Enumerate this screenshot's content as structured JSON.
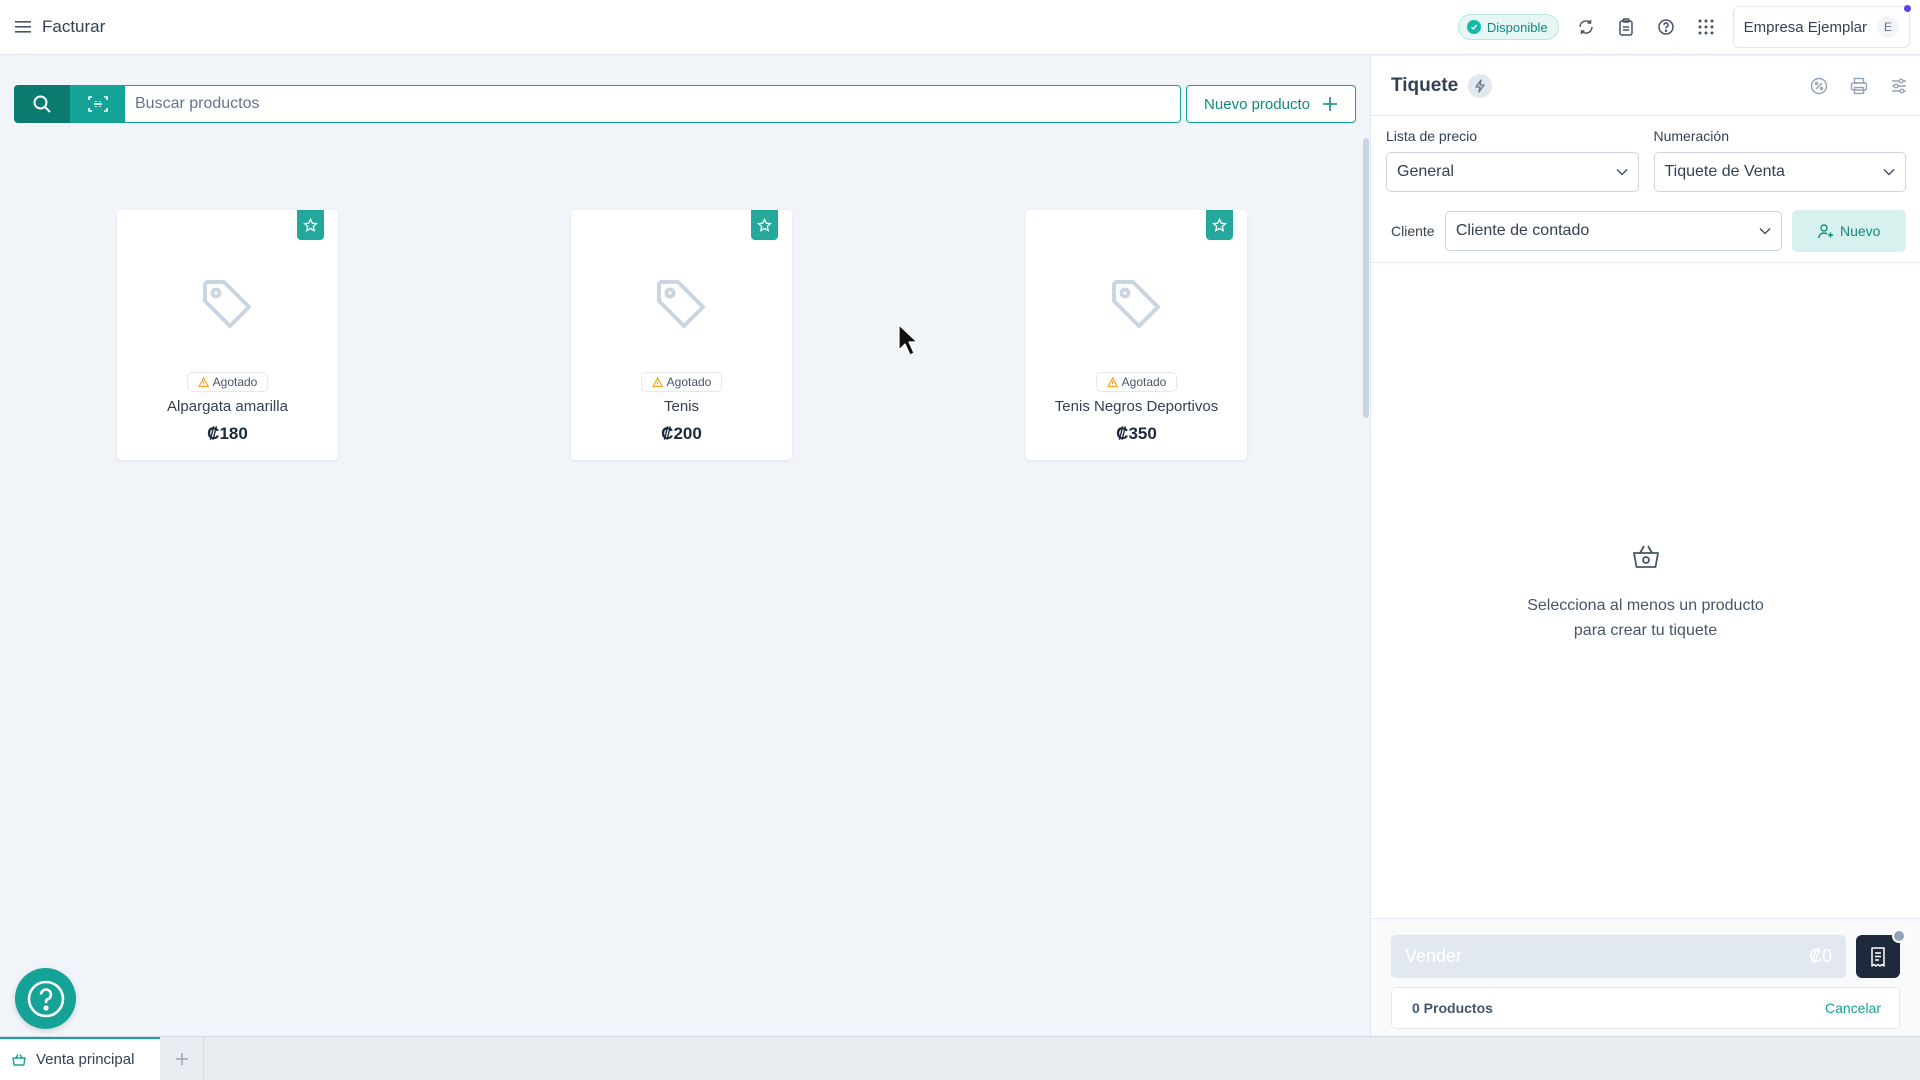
{
  "topbar": {
    "page_title": "Facturar",
    "status_label": "Disponible",
    "company_name": "Empresa Ejemplar",
    "company_initial": "E"
  },
  "search": {
    "placeholder": "Buscar productos",
    "new_product_label": "Nuevo producto"
  },
  "products": [
    {
      "name": "Alpargata amarilla",
      "price": "₡180",
      "badge": "Agotado"
    },
    {
      "name": "Tenis",
      "price": "₡200",
      "badge": "Agotado"
    },
    {
      "name": "Tenis Negros Deportivos",
      "price": "₡350",
      "badge": "Agotado"
    }
  ],
  "panel": {
    "title": "Tiquete",
    "price_list_label": "Lista de precio",
    "price_list_value": "General",
    "numbering_label": "Numeración",
    "numbering_value": "Tiquete de Venta",
    "client_label": "Cliente",
    "client_value": "Cliente de contado",
    "new_client_label": "Nuevo",
    "empty_line1": "Selecciona al menos un producto",
    "empty_line2": "para crear tu tiquete",
    "sell_label": "Vender",
    "sell_amount": "₡0",
    "products_count": "0 Productos",
    "cancel_label": "Cancelar"
  },
  "tabs": [
    {
      "label": "Venta principal"
    }
  ],
  "colors": {
    "primary": "#14a396",
    "primary_dark": "#0b7a6f",
    "accent_bg": "#d7f1ee"
  }
}
